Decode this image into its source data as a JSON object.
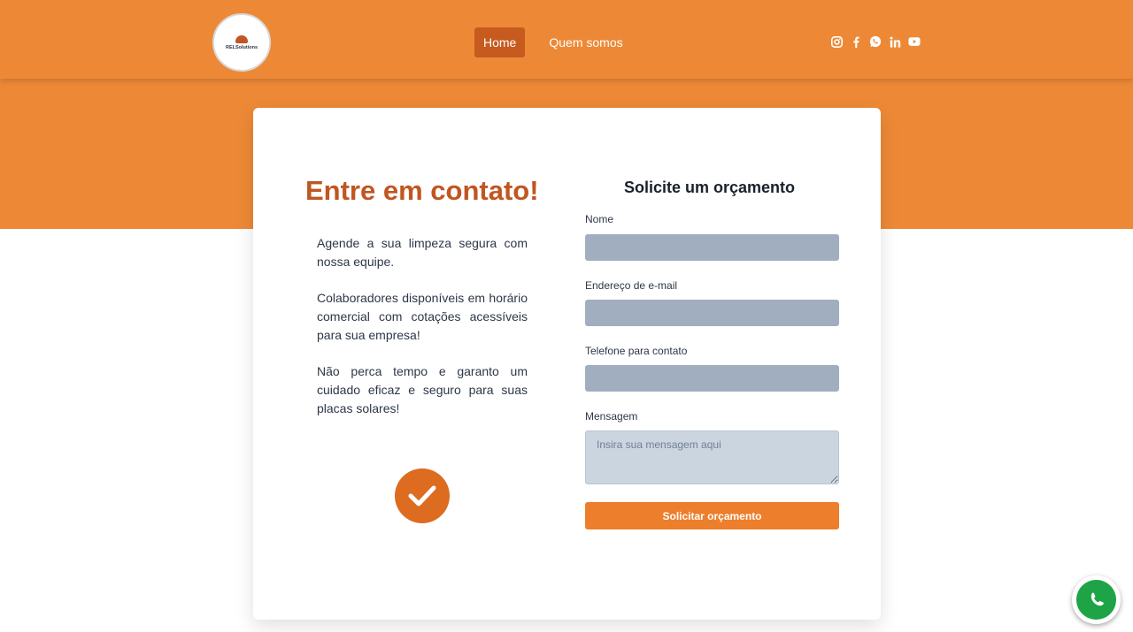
{
  "header": {
    "logo_text": "RELSolutions",
    "nav": [
      {
        "label": "Home",
        "active": true
      },
      {
        "label": "Quem somos",
        "active": false
      }
    ],
    "social_icons": [
      "instagram-icon",
      "facebook-icon",
      "whatsapp-icon",
      "linkedin-icon",
      "youtube-icon"
    ]
  },
  "contact": {
    "title": "Entre em contato!",
    "paragraphs": [
      "Agende a sua limpeza segura com nossa equipe.",
      "Colaboradores disponíveis em horário comercial com cotações acessíveis para sua empresa!",
      "Não perca tempo e garanto um cuidado eficaz e seguro para suas placas solares!"
    ],
    "check_icon": "check-circle-icon"
  },
  "form": {
    "title": "Solicite um orçamento",
    "name_label": "Nome",
    "name_value": "",
    "email_label": "Endereço de e-mail",
    "email_value": "",
    "phone_label": "Telefone para contato",
    "phone_value": "",
    "message_label": "Mensagem",
    "message_placeholder": "Insira sua mensagem aqui",
    "submit_label": "Solicitar orçamento"
  },
  "floating": {
    "icon": "whatsapp-icon"
  },
  "colors": {
    "brand_orange": "#ed8936",
    "title_orange": "#c05621",
    "button_orange": "#ed7e2c",
    "input_gray": "#a0aec0",
    "whatsapp_green": "#1ea446"
  }
}
